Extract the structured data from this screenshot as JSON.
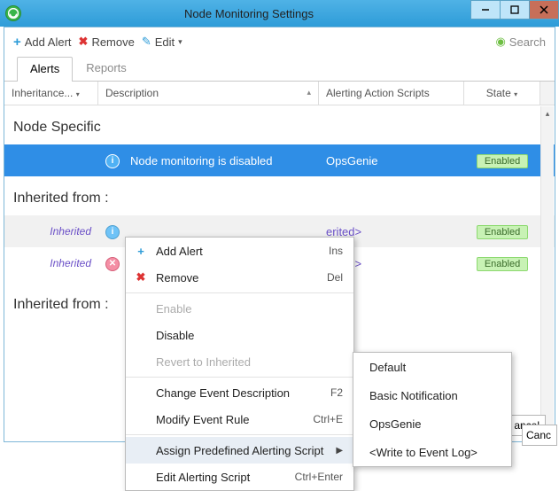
{
  "window": {
    "title": "Node Monitoring Settings"
  },
  "toolbar": {
    "add": "Add Alert",
    "remove": "Remove",
    "edit": "Edit"
  },
  "search": {
    "placeholder": "Search"
  },
  "tabs": {
    "alerts": "Alerts",
    "reports": "Reports"
  },
  "grid": {
    "headers": {
      "inheritance": "Inheritance...",
      "description": "Description",
      "actionScripts": "Alerting Action Scripts",
      "state": "State"
    },
    "sections": {
      "nodeSpecific": "Node Specific",
      "inheritedFromTrunc": "Inherited from : ",
      "inheritedFromTrunc2": "Inherited from : "
    },
    "rows": [
      {
        "inherit": "",
        "desc": "Node monitoring is disabled",
        "action": "OpsGenie",
        "state": "Enabled"
      },
      {
        "inherit": "Inherited",
        "desc": "",
        "action": "erited>",
        "state": "Enabled"
      },
      {
        "inherit": "Inherited",
        "desc": "",
        "action": "erited>",
        "state": "Enabled"
      }
    ]
  },
  "contextMenu": {
    "items": {
      "addAlert": {
        "label": "Add Alert",
        "shortcut": "Ins"
      },
      "remove": {
        "label": "Remove",
        "shortcut": "Del"
      },
      "enable": {
        "label": "Enable"
      },
      "disable": {
        "label": "Disable"
      },
      "revert": {
        "label": "Revert to Inherited"
      },
      "changeDesc": {
        "label": "Change Event Description",
        "shortcut": "F2"
      },
      "modifyRule": {
        "label": "Modify Event Rule",
        "shortcut": "Ctrl+E"
      },
      "assignScript": {
        "label": "Assign Predefined Alerting Script"
      },
      "editScript": {
        "label": "Edit Alerting Script",
        "shortcut": "Ctrl+Enter"
      }
    },
    "submenu": {
      "default": "Default",
      "basic": "Basic Notification",
      "opsgenie": "OpsGenie",
      "writeLog": "<Write to Event Log>"
    }
  },
  "buttons": {
    "cancel": "Cancel",
    "cancelTrunc": "ancel",
    "cancelTrunc2": "Canc"
  }
}
